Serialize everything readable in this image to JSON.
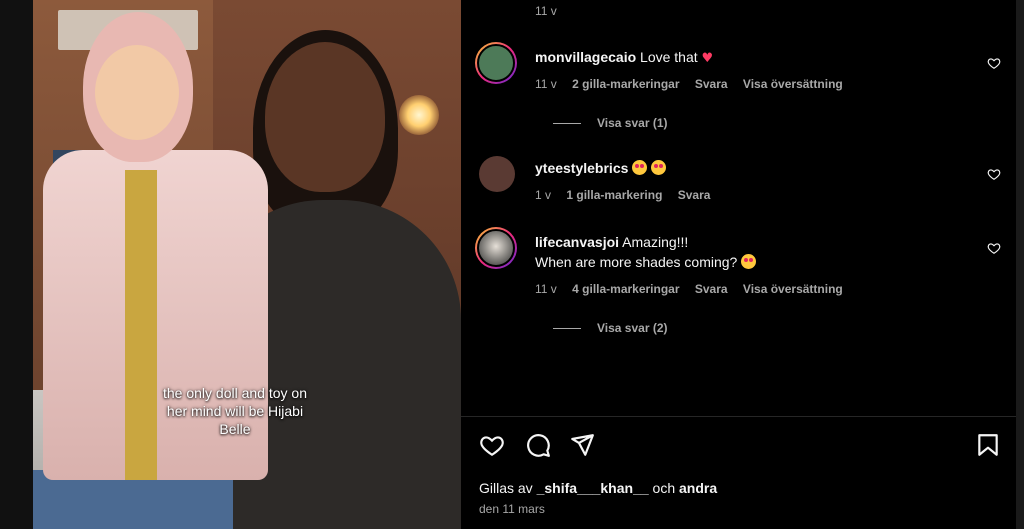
{
  "media": {
    "caption": "the only doll and toy on her mind will be Hijabi Belle"
  },
  "top_timestamp": "11 v",
  "comments": [
    {
      "username": "monvillagecaio",
      "text": "Love that",
      "emoji": "red-heart",
      "time": "11 v",
      "likes": "2 gilla-markeringar",
      "reply": "Svara",
      "translate": "Visa översättning",
      "view_replies": "Visa svar (1)"
    },
    {
      "username": "yteestylebrics",
      "text": "",
      "emoji": "star-struck x2",
      "time": "1 v",
      "likes": "1 gilla-markering",
      "reply": "Svara"
    },
    {
      "username": "lifecanvasjoi",
      "text": "Amazing!!!",
      "text_line2": "When are more shades coming?",
      "emoji": "star-struck",
      "time": "11 v",
      "likes": "4 gilla-markeringar",
      "reply": "Svara",
      "translate": "Visa översättning",
      "view_replies": "Visa svar (2)"
    }
  ],
  "actions": {
    "like_icon": "heart-outline-icon",
    "comment_icon": "comment-bubble-icon",
    "share_icon": "paper-plane-icon",
    "save_icon": "bookmark-icon"
  },
  "likes_summary": {
    "prefix": "Gillas av",
    "user": "_shifa___khan__",
    "conjunction": "och",
    "others": "andra"
  },
  "post_date": "den 11 mars",
  "colors": {
    "background": "#000000",
    "muted": "#a8a8a8",
    "heart": "#ff3b64"
  }
}
